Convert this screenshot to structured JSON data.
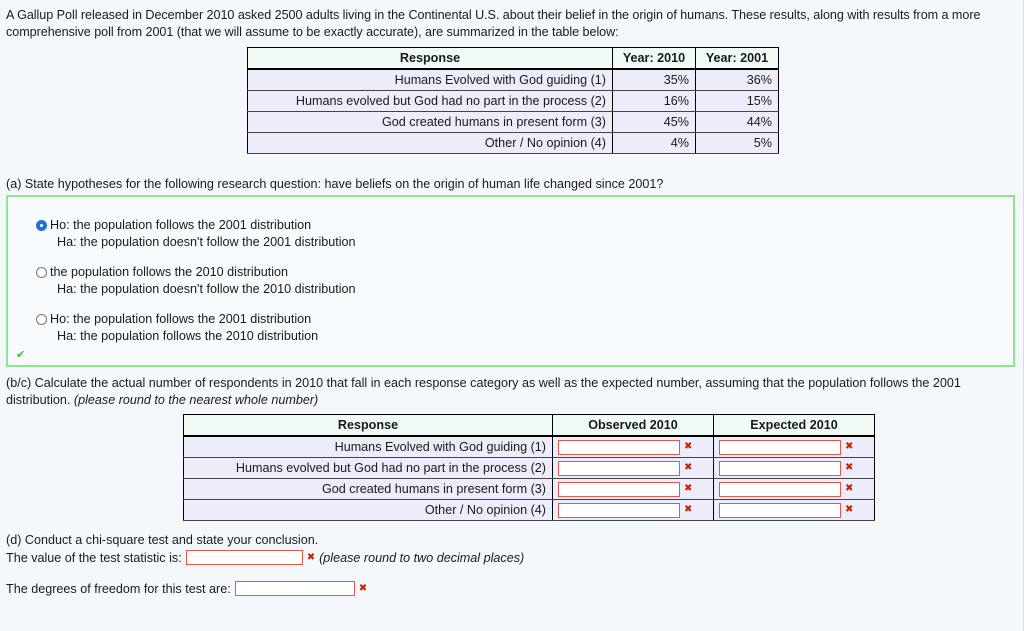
{
  "intro": {
    "paragraph": "A Gallup Poll released in December 2010 asked 2500 adults living in the Continental U.S. about their belief in the origin of humans. These results, along with results from a more comprehensive poll from 2001 (that we will assume to be exactly accurate), are summarized in the table below:"
  },
  "poll_table": {
    "headers": [
      "Response",
      "Year: 2010",
      "Year: 2001"
    ],
    "rows": [
      {
        "response": "Humans Evolved with God guiding (1)",
        "y2010": "35%",
        "y2001": "36%"
      },
      {
        "response": "Humans evolved but God had no part in the process (2)",
        "y2010": "16%",
        "y2001": "15%"
      },
      {
        "response": "God created humans in present form (3)",
        "y2010": "45%",
        "y2001": "44%"
      },
      {
        "response": "Other / No opinion (4)",
        "y2010": "4%",
        "y2001": "5%"
      }
    ]
  },
  "question_a": {
    "prompt": "(a) State hypotheses for the following research question: have beliefs on the origin of human life changed since 2001?",
    "options": [
      {
        "line1": "Ho: the population follows the 2001 distribution",
        "line2": "Ha: the population doesn't follow the 2001 distribution",
        "selected": true
      },
      {
        "line1": "the population follows the 2010 distribution",
        "line2": "Ha: the population doesn't follow the 2010 distribution",
        "selected": false
      },
      {
        "line1": "Ho: the population follows the 2001 distribution",
        "line2": "Ha: the population follows the 2010 distribution",
        "selected": false
      }
    ],
    "status_icon": "✔",
    "box_border_color": "#8ae88a"
  },
  "question_bc": {
    "prompt": "(b/c) Calculate the actual number of respondents in 2010 that fall in each response category as well as the expected number, assuming that the population follows the 2001 distribution.",
    "hint": "(please round to the nearest whole number)",
    "table": {
      "headers": [
        "Response",
        "Observed 2010",
        "Expected 2010"
      ],
      "rows": [
        {
          "response": "Humans Evolved with God guiding (1)",
          "observed": "",
          "expected": ""
        },
        {
          "response": "Humans evolved but God had no part in the process (2)",
          "observed": "",
          "expected": ""
        },
        {
          "response": "God created humans in present form (3)",
          "observed": "",
          "expected": ""
        },
        {
          "response": "Other / No opinion (4)",
          "observed": "",
          "expected": ""
        }
      ],
      "required_marker": "✖"
    }
  },
  "question_d": {
    "prompt": "(d) Conduct a chi-square test and state your conclusion.",
    "statistic_label": "The value of the test statistic is:",
    "statistic_value": "",
    "statistic_hint": "(please round to two decimal places)",
    "df_label": "The degrees of freedom for this test are:",
    "df_value": "",
    "required_marker": "✖"
  },
  "colors": {
    "page_background": "#f4f8fc",
    "header_cell": "#f0fbf8",
    "data_cell": "#ececfa",
    "input_border": "#e8564a",
    "marker": "#cc2200",
    "radio_selected": "#1f73d8"
  }
}
